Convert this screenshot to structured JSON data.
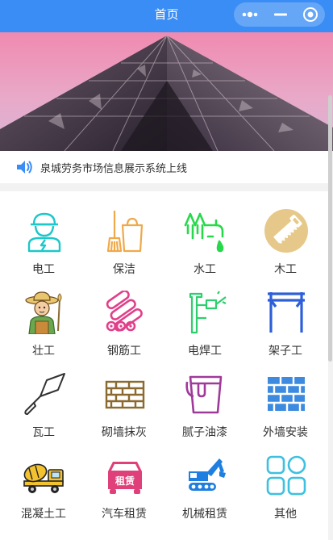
{
  "header": {
    "title": "首页"
  },
  "capsule": {
    "more_icon": "more-dots-icon",
    "minimize_icon": "minus-icon",
    "close_icon": "target-circle-icon"
  },
  "notice": {
    "icon": "speaker-icon",
    "text": "泉城劳务市场信息展示系统上线"
  },
  "categories": [
    {
      "label": "电工",
      "icon": "electrician-icon"
    },
    {
      "label": "保洁",
      "icon": "cleaning-icon"
    },
    {
      "label": "水工",
      "icon": "plumber-icon"
    },
    {
      "label": "木工",
      "icon": "carpenter-saw-icon"
    },
    {
      "label": "壮工",
      "icon": "laborer-icon"
    },
    {
      "label": "钢筋工",
      "icon": "rebar-icon"
    },
    {
      "label": "电焊工",
      "icon": "welder-icon"
    },
    {
      "label": "架子工",
      "icon": "scaffold-icon"
    },
    {
      "label": "瓦工",
      "icon": "trowel-icon"
    },
    {
      "label": "砌墙抹灰",
      "icon": "brick-wall-icon"
    },
    {
      "label": "腻子油漆",
      "icon": "paint-bucket-icon"
    },
    {
      "label": "外墙安装",
      "icon": "exterior-wall-icon"
    },
    {
      "label": "混凝土工",
      "icon": "cement-mixer-icon"
    },
    {
      "label": "汽车租赁",
      "icon": "car-rental-icon"
    },
    {
      "label": "机械租赁",
      "icon": "excavator-icon"
    },
    {
      "label": "其他",
      "icon": "other-grid-icon"
    }
  ],
  "rental_badge": "租赁",
  "colors": {
    "header": "#3a8df5",
    "indicator_active": "#e6231c",
    "notice_icon": "#3a8df5"
  }
}
